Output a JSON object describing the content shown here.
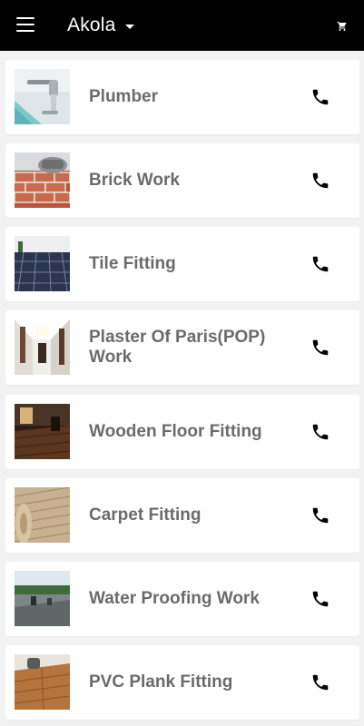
{
  "app_bar": {
    "city": "Akola",
    "menu_icon": "menu-icon",
    "dropdown_icon": "caret-down-icon",
    "cart_icon": "cart-icon"
  },
  "services": [
    {
      "title": "Plumber",
      "icon": "phone-icon"
    },
    {
      "title": "Brick Work",
      "icon": "phone-icon"
    },
    {
      "title": "Tile Fitting",
      "icon": "phone-icon"
    },
    {
      "title": "Plaster Of Paris(POP) Work",
      "icon": "phone-icon"
    },
    {
      "title": "Wooden Floor Fitting",
      "icon": "phone-icon"
    },
    {
      "title": "Carpet Fitting",
      "icon": "phone-icon"
    },
    {
      "title": "Water Proofing Work",
      "icon": "phone-icon"
    },
    {
      "title": "PVC Plank Fitting",
      "icon": "phone-icon"
    }
  ],
  "colors": {
    "app_bar_bg": "#000000",
    "background": "#f2f2f2",
    "card_bg": "#ffffff",
    "title_text": "#6b6b6b",
    "icon": "#000000"
  }
}
